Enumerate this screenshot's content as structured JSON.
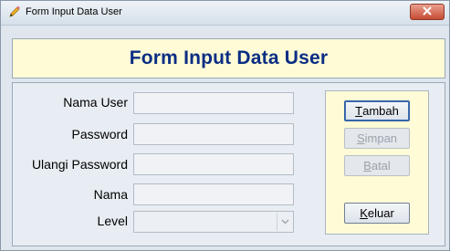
{
  "window": {
    "title": "Form Input Data User"
  },
  "header": {
    "title": "Form Input Data User"
  },
  "form": {
    "labels": {
      "nama_user": "Nama User",
      "password": "Password",
      "ulangi_password": "Ulangi Password",
      "nama": "Nama",
      "level": "Level"
    },
    "values": {
      "nama_user": "",
      "password": "",
      "ulangi_password": "",
      "nama": "",
      "level": ""
    }
  },
  "buttons": {
    "tambah": {
      "accel": "T",
      "rest": "ambah",
      "enabled": true
    },
    "simpan": {
      "accel": "S",
      "rest": "impan",
      "enabled": false
    },
    "batal": {
      "accel": "B",
      "rest": "atal",
      "enabled": false
    },
    "keluar": {
      "accel": "K",
      "rest": "eluar",
      "enabled": true
    }
  },
  "colors": {
    "header_bg": "#fffbd6",
    "header_text": "#0a2d84",
    "close_button": "#c74a33"
  },
  "icons": {
    "app": "pencil-icon",
    "close": "close-icon",
    "dropdown": "chevron-down-icon"
  }
}
